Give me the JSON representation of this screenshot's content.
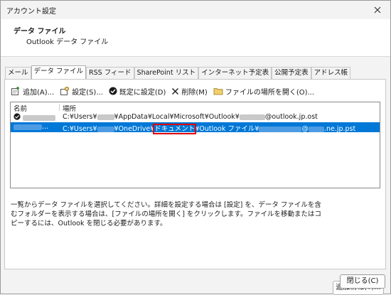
{
  "window": {
    "title": "アカウント設定"
  },
  "header": {
    "title": "データ ファイル",
    "subtitle": "Outlook データ ファイル"
  },
  "tabs": [
    {
      "label": "メール"
    },
    {
      "label": "データ ファイル"
    },
    {
      "label": "RSS フィード"
    },
    {
      "label": "SharePoint リスト"
    },
    {
      "label": "インターネット予定表"
    },
    {
      "label": "公開予定表"
    },
    {
      "label": "アドレス帳"
    }
  ],
  "active_tab": "データ ファイル",
  "toolbar": {
    "add": "追加(A)...",
    "settings": "設定(S)...",
    "set_default": "既定に設定(D)",
    "delete": "削除(M)",
    "open_location": "ファイルの場所を開く(O)..."
  },
  "list": {
    "columns": {
      "name": "名前",
      "location": "場所"
    },
    "rows": [
      {
        "name": "",
        "is_default": true,
        "loc": {
          "p1": "C:¥Users¥",
          "p2": "¥AppData¥Local¥Microsoft¥Outlook¥",
          "p3": "@outlook.jp.ost"
        }
      },
      {
        "name": "...",
        "is_default": false,
        "selected": true,
        "loc": {
          "p1": "C:¥Users¥",
          "p2": "¥OneDrive¥",
          "hl": "ドキュメント",
          "p3": "¥Outlook ファイル¥",
          "p4": "@",
          "p5": ".ne.jp.pst"
        }
      }
    ]
  },
  "description": "一覧からデータ ファイルを選択してください。詳細を設定する場合は [設定] を、データ ファイルを含むフォルダーを表示する場合は、[ファイルの場所を開く] をクリックします。ファイルを移動またはコピーするには、Outlook を閉じる必要があります。",
  "buttons": {
    "more_info": "追加情報(T)...",
    "close": "閉じる(C)"
  },
  "colors": {
    "selection": "#0078d7",
    "highlight_box": "#e00000"
  }
}
